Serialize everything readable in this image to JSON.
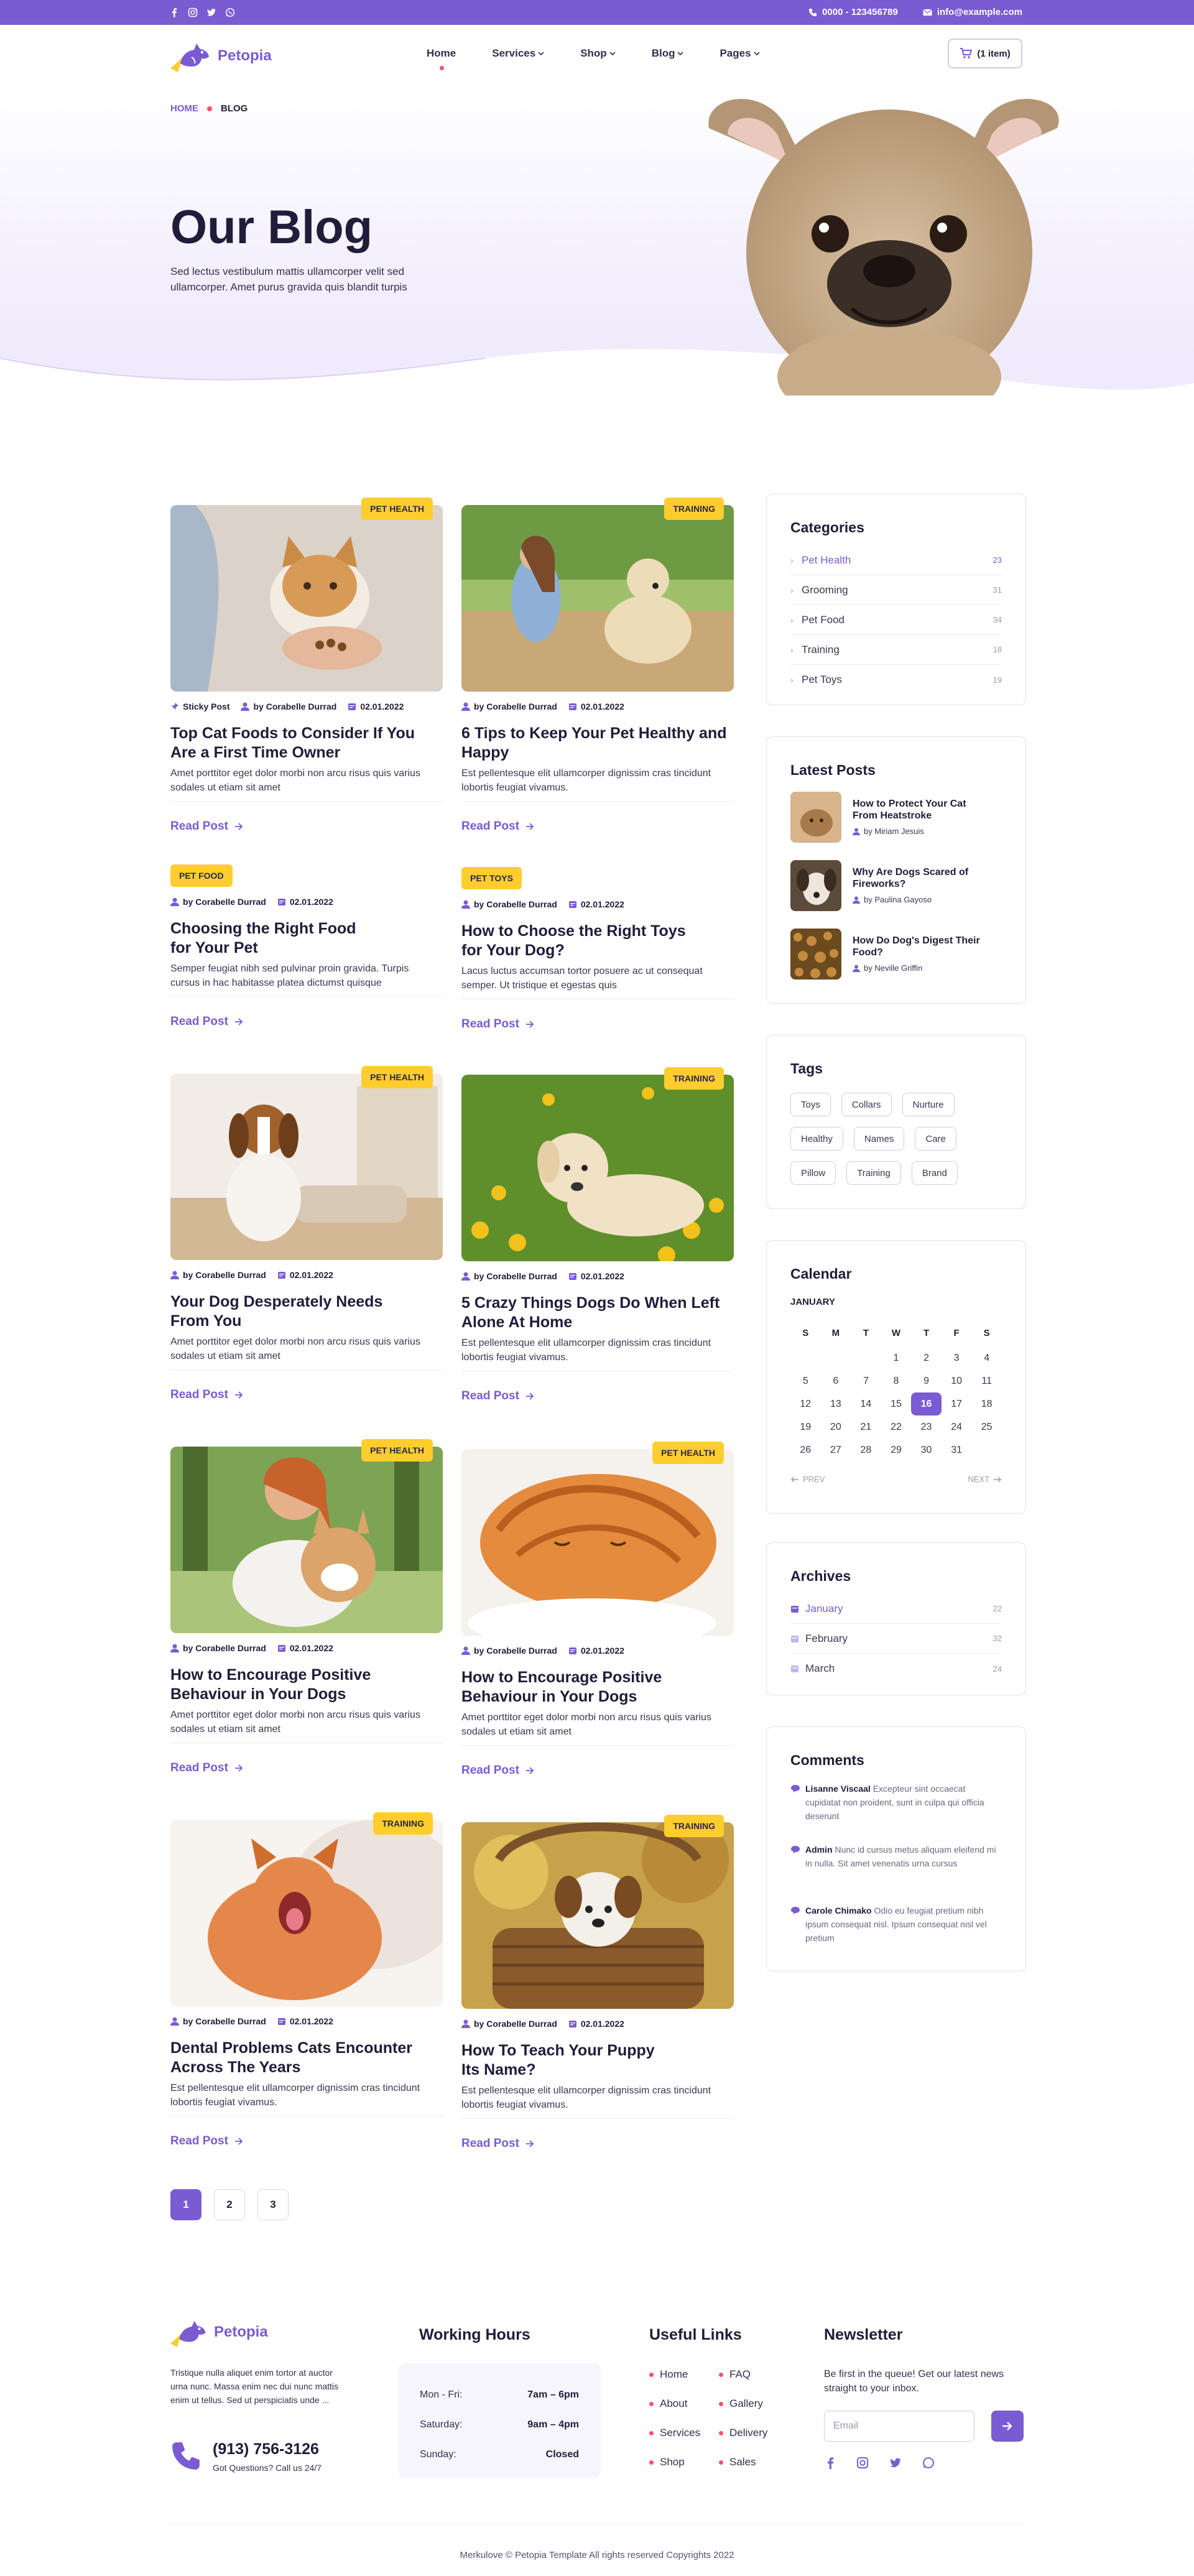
{
  "topbar": {
    "phone": "0000 - 123456789",
    "email": "info@example.com",
    "social_icons": [
      "facebook-icon",
      "instagram-icon",
      "twitter-icon",
      "whatsapp-icon"
    ]
  },
  "brand": {
    "name": "Petopia",
    "color": "#7a5bd2",
    "accent": "#ffcd2e",
    "dot": "#ff4d6d"
  },
  "nav": {
    "items": [
      {
        "label": "Home"
      },
      {
        "label": "Services"
      },
      {
        "label": "Shop"
      },
      {
        "label": "Blog"
      },
      {
        "label": "Pages"
      }
    ],
    "cart": "(1 item)"
  },
  "hero": {
    "crumb_home": "HOME",
    "crumb_current": "BLOG",
    "title": "Our Blog",
    "lead": "Sed lectus vestibulum mattis ullamcorper velit sed ullamcorper. Amet purus gravida quis blandit turpis"
  },
  "posts": [
    {
      "tag": "PET HEALTH",
      "sticky": "Sticky Post",
      "author": "by Corabelle Durrad",
      "date": "02.01.2022",
      "title": "Top Cat Foods to Consider If You Are a First Time Owner",
      "excerpt": "Amet porttitor eget dolor morbi non arcu risus quis varius  sodales ut etiam sit amet",
      "read": "Read Post",
      "image": "cat-eating-photo"
    },
    {
      "tag": "TRAINING",
      "author": "by Corabelle Durrad",
      "date": "02.01.2022",
      "title": "6 Tips to Keep Your Pet Healthy and Happy",
      "excerpt": "Est pellentesque elit ullamcorper dignissim cras tincidunt lobortis feugiat vivamus.",
      "read": "Read Post",
      "image": "woman-with-dog-photo"
    },
    {
      "tag": "PET FOOD",
      "author": "by Corabelle Durrad",
      "date": "02.01.2022",
      "title": "Choosing the Right Food\nfor Your Pet",
      "excerpt": "Semper feugiat nibh sed pulvinar proin gravida. Turpis cursus in hac habitasse platea dictumst quisque",
      "read": "Read Post"
    },
    {
      "tag": "PET TOYS",
      "author": "by Corabelle Durrad",
      "date": "02.01.2022",
      "title": "How to Choose the Right Toys\nfor Your Dog?",
      "excerpt": "Lacus luctus accumsan tortor posuere ac ut consequat semper. Ut tristique et egestas quis",
      "read": "Read Post"
    },
    {
      "tag": "PET HEALTH",
      "author": "by Corabelle Durrad",
      "date": "02.01.2022",
      "title": "Your Dog Desperately Needs\nFrom You",
      "excerpt": "Amet porttitor eget dolor morbi non arcu risus quis varius  sodales ut etiam sit amet",
      "read": "Read Post",
      "image": "beagle-on-sofa-photo"
    },
    {
      "tag": "TRAINING",
      "author": "by Corabelle Durrad",
      "date": "02.01.2022",
      "title": "5 Crazy Things Dogs Do When Left Alone At Home",
      "excerpt": "Est pellentesque elit ullamcorper dignissim cras tincidunt lobortis feugiat vivamus.",
      "read": "Read Post",
      "image": "labrador-in-flowers-photo"
    },
    {
      "tag": "PET HEALTH",
      "author": "by Corabelle Durrad",
      "date": "02.01.2022",
      "title": "How to Encourage Positive Behaviour in Your Dogs",
      "excerpt": "Amet porttitor eget dolor morbi non arcu risus quis varius  sodales ut etiam sit amet",
      "read": "Read Post",
      "image": "woman-with-corgi-photo"
    },
    {
      "tag": "PET HEALTH",
      "author": "by Corabelle Durrad",
      "date": "02.01.2022",
      "title": "How to Encourage Positive Behaviour in Your Dogs",
      "excerpt": "Amet porttitor eget dolor morbi non arcu risus quis varius  sodales ut etiam sit amet",
      "read": "Read Post",
      "image": "sleeping-kitten-photo"
    },
    {
      "tag": "TRAINING",
      "author": "by Corabelle Durrad",
      "date": "02.01.2022",
      "title": "Dental Problems Cats Encounter Across The Years",
      "excerpt": "Est pellentesque elit ullamcorper dignissim cras tincidunt lobortis feugiat vivamus.",
      "read": "Read Post",
      "image": "yawning-cat-photo"
    },
    {
      "tag": "TRAINING",
      "author": "by Corabelle Durrad",
      "date": "02.01.2022",
      "title": "How To Teach Your Puppy\n Its Name?",
      "excerpt": "Est pellentesque elit ullamcorper dignissim cras tincidunt lobortis feugiat vivamus.",
      "read": "Read Post",
      "image": "puppy-in-basket-photo"
    }
  ],
  "pagination": [
    "1",
    "2",
    "3"
  ],
  "sidebar": {
    "categories": {
      "title": "Categories",
      "items": [
        {
          "label": "Pet Health",
          "count": "23"
        },
        {
          "label": "Grooming",
          "count": "31"
        },
        {
          "label": "Pet Food",
          "count": "34"
        },
        {
          "label": "Training",
          "count": "18"
        },
        {
          "label": "Pet Toys",
          "count": "19"
        }
      ]
    },
    "latest": {
      "title": "Latest Posts",
      "items": [
        {
          "title": "How to Protect Your Cat From Heatstroke",
          "author": "by Miriam Jesuis"
        },
        {
          "title": "Why Are Dogs Scared of Fireworks?",
          "author": "by Paulina Gayoso"
        },
        {
          "title": "How Do Dog's Digest Their Food?",
          "author": "by Neville Griffin"
        }
      ]
    },
    "tags": {
      "title": "Tags",
      "items": [
        "Toys",
        "Collars",
        "Nurture",
        "Healthy",
        "Names",
        "Care",
        "Pillow",
        "Training",
        "Brand"
      ]
    },
    "calendar": {
      "title": "Calendar",
      "month": "JANUARY",
      "days": [
        "S",
        "M",
        "T",
        "W",
        "T",
        "F",
        "S"
      ],
      "weeks": [
        [
          "",
          "",
          "",
          "1",
          "2",
          "3",
          "4"
        ],
        [
          "5",
          "6",
          "7",
          "8",
          "9",
          "10",
          "11"
        ],
        [
          "12",
          "13",
          "14",
          "15",
          "16",
          "17",
          "18"
        ],
        [
          "19",
          "20",
          "21",
          "22",
          "23",
          "24",
          "25"
        ],
        [
          "26",
          "27",
          "28",
          "29",
          "30",
          "31",
          ""
        ]
      ],
      "today": "16",
      "prev": "PREV",
      "next": "NEXT"
    },
    "archives": {
      "title": "Archives",
      "items": [
        {
          "label": "January",
          "count": "22"
        },
        {
          "label": "February",
          "count": "32"
        },
        {
          "label": "March",
          "count": "24"
        }
      ]
    },
    "comments": {
      "title": "Comments",
      "items": [
        {
          "name": "Lisanne Viscaal",
          "text": "Excepteur sint occaecat cupidatat non proident, sunt in culpa qui officia deserunt"
        },
        {
          "name": "Admin",
          "text": "Nunc id cursus metus aliquam eleifend mi in nulla. Sit amet venenatis urna cursus"
        },
        {
          "name": "Carole Chimako",
          "text": "Odio eu feugiat pretium nibh ipsum consequat nisl. Ipsum consequat nisl vel pretium"
        }
      ]
    }
  },
  "footer": {
    "about": "Tristique nulla aliquet enim tortor at auctor urna nunc. Massa enim nec dui nunc mattis enim ut tellus. Sed ut perspiciatis unde ...",
    "phone": "(913) 756-3126",
    "phone_sub": "Got Questions? Call us 24/7",
    "hours_title": "Working Hours",
    "hours": [
      {
        "day": "Mon - Fri:",
        "time": "7am – 6pm"
      },
      {
        "day": "Saturday:",
        "time": "9am – 4pm"
      },
      {
        "day": "Sunday:",
        "time": "Closed"
      }
    ],
    "links_title": "Useful Links",
    "links_col1": [
      "Home",
      "About",
      "Services",
      "Shop"
    ],
    "links_col2": [
      "FAQ",
      "Gallery",
      "Delivery",
      "Sales"
    ],
    "newsletter_title": "Newsletter",
    "newsletter_text": "Be first in the queue! Get our latest news straight to your inbox.",
    "email_placeholder": "Email",
    "copyright": "Merkulove © Petopia Template All rights reserved Copyrights 2022"
  }
}
